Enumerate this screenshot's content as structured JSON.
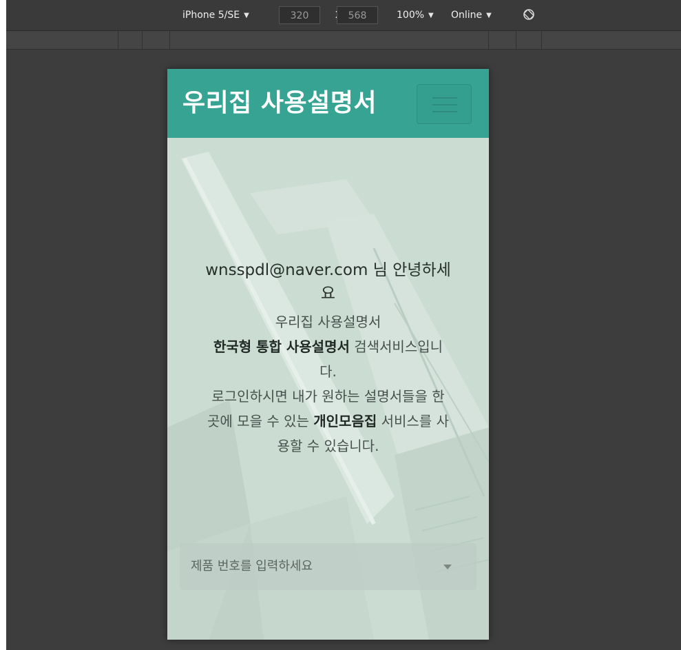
{
  "devtools": {
    "device": "iPhone 5/SE",
    "width": "320",
    "times": "x",
    "height": "568",
    "zoom": "100%",
    "network": "Online"
  },
  "navbar": {
    "brand": "우리집 사용설명서"
  },
  "hero": {
    "greeting_line1": "wnsspdl@naver.com 님 안녕하세",
    "greeting_line2": "요",
    "intro_line1": "우리집 사용설명서",
    "intro_bold1": "한국형 통합 사용설명서",
    "intro_line2_rest": " 검색서비스입니",
    "intro_line3": "다.",
    "intro_line4": "로그인하시면 내가 원하는 설명서들을 한",
    "intro_line5_pre": "곳에 모을 수 있는 ",
    "intro_bold2": "개인모음집",
    "intro_line5_post": " 서비스를 사",
    "intro_line6": "용할 수 있습니다."
  },
  "search": {
    "placeholder": "제품 번호를 입력하세요"
  }
}
